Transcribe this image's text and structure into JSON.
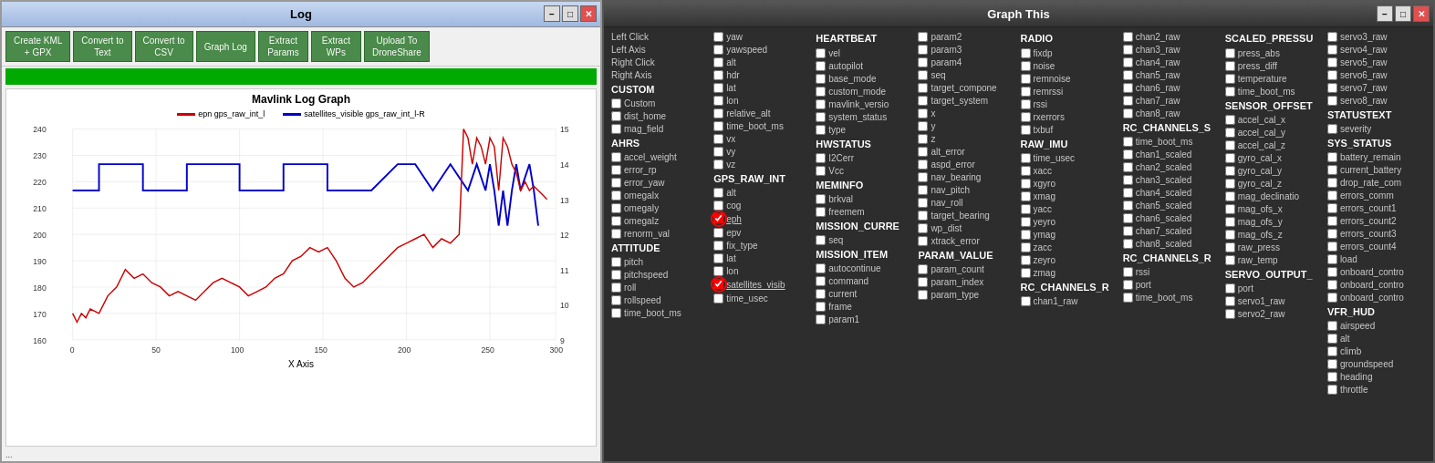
{
  "left_window": {
    "title": "Log",
    "controls": {
      "minimize": "−",
      "maximize": "□",
      "close": "✕"
    },
    "toolbar_buttons": [
      {
        "label": "Create KML\n+ GPX",
        "id": "create-kml"
      },
      {
        "label": "Convert to\nText",
        "id": "convert-text"
      },
      {
        "label": "Convert to\nCSV",
        "id": "convert-csv"
      },
      {
        "label": "Graph Log",
        "id": "graph-log"
      },
      {
        "label": "Extract\nParams",
        "id": "extract-params"
      },
      {
        "label": "Extract\nWPs",
        "id": "extract-wps"
      },
      {
        "label": "Upload To\nDroneShare",
        "id": "upload-droneshare"
      }
    ],
    "graph": {
      "title": "Mavlink Log Graph",
      "legend": [
        {
          "label": "epn gps_raw_int_l",
          "color": "#cc0000"
        },
        {
          "label": "satellites_visible gps_raw_int_l-R",
          "color": "#0000cc"
        }
      ],
      "y_axis_left_min": 150,
      "y_axis_left_max": 240,
      "y_axis_right_min": 7,
      "y_axis_right_max": 15,
      "x_axis_label": "X Axis",
      "x_axis_values": [
        "0",
        "50",
        "100",
        "150",
        "200",
        "250",
        "300"
      ],
      "footer": "..."
    }
  },
  "right_window": {
    "title": "Graph This",
    "controls": {
      "minimize": "−",
      "maximize": "□",
      "close": "✕"
    },
    "columns": [
      {
        "id": "col1",
        "header": "",
        "items": [
          {
            "type": "label",
            "text": "Left Click"
          },
          {
            "type": "label",
            "text": "Left Axis"
          },
          {
            "type": "label",
            "text": "Right Click"
          },
          {
            "type": "label",
            "text": "Right Axis"
          },
          {
            "type": "section",
            "text": "CUSTOM"
          },
          {
            "type": "checkbox",
            "text": "Custom"
          },
          {
            "type": "checkbox",
            "text": "dist_home"
          },
          {
            "type": "checkbox",
            "text": "mag_field"
          },
          {
            "type": "section",
            "text": "AHRS"
          },
          {
            "type": "checkbox",
            "text": "accel_weight"
          },
          {
            "type": "checkbox",
            "text": "error_rp"
          },
          {
            "type": "checkbox",
            "text": "error_yaw"
          },
          {
            "type": "checkbox",
            "text": "omegaIx"
          },
          {
            "type": "checkbox",
            "text": "omegaIy"
          },
          {
            "type": "checkbox",
            "text": "omegaIz"
          },
          {
            "type": "checkbox",
            "text": "renorm_val"
          },
          {
            "type": "section",
            "text": "ATTITUDE"
          },
          {
            "type": "checkbox",
            "text": "pitch"
          },
          {
            "type": "checkbox",
            "text": "pitchspeed"
          },
          {
            "type": "checkbox",
            "text": "roll"
          },
          {
            "type": "checkbox",
            "text": "rollspeed"
          },
          {
            "type": "checkbox",
            "text": "time_boot_ms"
          }
        ]
      },
      {
        "id": "col2",
        "header": "",
        "items": [
          {
            "type": "checkbox",
            "text": "yaw"
          },
          {
            "type": "checkbox",
            "text": "yawspeed"
          },
          {
            "type": "checkbox",
            "text": "alt"
          },
          {
            "type": "checkbox",
            "text": "hdr"
          },
          {
            "type": "checkbox",
            "text": "lat"
          },
          {
            "type": "checkbox",
            "text": "lon"
          },
          {
            "type": "checkbox",
            "text": "relative_alt"
          },
          {
            "type": "checkbox",
            "text": "time_boot_ms"
          },
          {
            "type": "checkbox",
            "text": "vx"
          },
          {
            "type": "checkbox",
            "text": "vy"
          },
          {
            "type": "checkbox",
            "text": "vz"
          },
          {
            "type": "section",
            "text": "GPS_RAW_INT"
          },
          {
            "type": "checkbox",
            "text": "alt"
          },
          {
            "type": "checkbox",
            "text": "cog"
          },
          {
            "type": "checkbox-circled",
            "text": "eph"
          },
          {
            "type": "checkbox",
            "text": "epv"
          },
          {
            "type": "checkbox",
            "text": "fix_type"
          },
          {
            "type": "checkbox",
            "text": "lat"
          },
          {
            "type": "checkbox",
            "text": "lon"
          },
          {
            "type": "checkbox-circled",
            "text": "satellites_visib"
          },
          {
            "type": "checkbox",
            "text": "time_usec"
          }
        ]
      },
      {
        "id": "col3",
        "header": "HEARTBEAT",
        "items": [
          {
            "type": "checkbox",
            "text": "vel"
          },
          {
            "type": "checkbox",
            "text": "autopilot"
          },
          {
            "type": "checkbox",
            "text": "base_mode"
          },
          {
            "type": "checkbox",
            "text": "custom_mode"
          },
          {
            "type": "checkbox",
            "text": "mavlink_versio"
          },
          {
            "type": "checkbox",
            "text": "system_status"
          },
          {
            "type": "checkbox",
            "text": "type"
          },
          {
            "type": "section",
            "text": "HWSTATUS"
          },
          {
            "type": "checkbox",
            "text": "I2Cerr"
          },
          {
            "type": "checkbox",
            "text": "Vcc"
          },
          {
            "type": "section",
            "text": "MEMINFO"
          },
          {
            "type": "checkbox",
            "text": "brkval"
          },
          {
            "type": "checkbox",
            "text": "freemem"
          },
          {
            "type": "section",
            "text": "MISSION_CURRE"
          },
          {
            "type": "checkbox",
            "text": "seq"
          },
          {
            "type": "section",
            "text": "MISSION_ITEM"
          },
          {
            "type": "checkbox",
            "text": "autocontinue"
          },
          {
            "type": "checkbox",
            "text": "command"
          },
          {
            "type": "checkbox",
            "text": "current"
          },
          {
            "type": "checkbox",
            "text": "frame"
          },
          {
            "type": "checkbox",
            "text": "param1"
          }
        ]
      },
      {
        "id": "col4",
        "header": "",
        "items": [
          {
            "type": "checkbox",
            "text": "param2"
          },
          {
            "type": "checkbox",
            "text": "param3"
          },
          {
            "type": "checkbox",
            "text": "param4"
          },
          {
            "type": "checkbox",
            "text": "seq"
          },
          {
            "type": "checkbox",
            "text": "target_compone"
          },
          {
            "type": "checkbox",
            "text": "target_system"
          },
          {
            "type": "checkbox",
            "text": "x"
          },
          {
            "type": "checkbox",
            "text": "y"
          },
          {
            "type": "checkbox",
            "text": "z"
          },
          {
            "type": "checkbox",
            "text": "alt_error"
          },
          {
            "type": "checkbox",
            "text": "aspd_error"
          },
          {
            "type": "checkbox",
            "text": "nav_bearing"
          },
          {
            "type": "checkbox",
            "text": "nav_pitch"
          },
          {
            "type": "checkbox",
            "text": "nav_roll"
          },
          {
            "type": "checkbox",
            "text": "target_bearing"
          },
          {
            "type": "checkbox",
            "text": "wp_dist"
          },
          {
            "type": "checkbox",
            "text": "xtrack_error"
          },
          {
            "type": "section",
            "text": "PARAM_VALUE"
          },
          {
            "type": "checkbox",
            "text": "param_count"
          },
          {
            "type": "checkbox",
            "text": "param_index"
          },
          {
            "type": "checkbox",
            "text": "param_type"
          }
        ]
      },
      {
        "id": "col5",
        "header": "RADIO",
        "items": [
          {
            "type": "checkbox",
            "text": "fixdp"
          },
          {
            "type": "checkbox",
            "text": "noise"
          },
          {
            "type": "checkbox",
            "text": "remnoise"
          },
          {
            "type": "checkbox",
            "text": "remrssi"
          },
          {
            "type": "checkbox",
            "text": "rssi"
          },
          {
            "type": "checkbox",
            "text": "rxerrors"
          },
          {
            "type": "checkbox",
            "text": "txbuf"
          },
          {
            "type": "section",
            "text": "RAW_IMU"
          },
          {
            "type": "checkbox",
            "text": "time_usec"
          },
          {
            "type": "checkbox",
            "text": "xacc"
          },
          {
            "type": "checkbox",
            "text": "xgyro"
          },
          {
            "type": "checkbox",
            "text": "xmag"
          },
          {
            "type": "checkbox",
            "text": "yacc"
          },
          {
            "type": "checkbox",
            "text": "yeyro"
          },
          {
            "type": "checkbox",
            "text": "ymag"
          },
          {
            "type": "checkbox",
            "text": "zacc"
          },
          {
            "type": "checkbox",
            "text": "zeyro"
          },
          {
            "type": "checkbox",
            "text": "zmag"
          },
          {
            "type": "section",
            "text": "RC_CHANNELS_R"
          },
          {
            "type": "checkbox",
            "text": "chan1_raw"
          }
        ]
      },
      {
        "id": "col6",
        "header": "",
        "items": [
          {
            "type": "checkbox",
            "text": "chan2_raw"
          },
          {
            "type": "checkbox",
            "text": "chan3_raw"
          },
          {
            "type": "checkbox",
            "text": "chan4_raw"
          },
          {
            "type": "checkbox",
            "text": "chan5_raw"
          },
          {
            "type": "checkbox",
            "text": "chan6_raw"
          },
          {
            "type": "checkbox",
            "text": "chan7_raw"
          },
          {
            "type": "checkbox",
            "text": "chan8_raw"
          },
          {
            "type": "section",
            "text": "RC_CHANNELS_S"
          },
          {
            "type": "checkbox",
            "text": "time_boot_ms"
          },
          {
            "type": "checkbox",
            "text": "chan1_scaled"
          },
          {
            "type": "checkbox",
            "text": "chan2_scaled"
          },
          {
            "type": "checkbox",
            "text": "chan3_scaled"
          },
          {
            "type": "checkbox",
            "text": "chan4_scaled"
          },
          {
            "type": "checkbox",
            "text": "chan5_scaled"
          },
          {
            "type": "checkbox",
            "text": "chan6_scaled"
          },
          {
            "type": "checkbox",
            "text": "chan7_scaled"
          },
          {
            "type": "checkbox",
            "text": "chan8_scaled"
          },
          {
            "type": "section",
            "text": "RC_CHANNELS_R"
          },
          {
            "type": "checkbox",
            "text": "rssi"
          },
          {
            "type": "checkbox",
            "text": "port"
          },
          {
            "type": "checkbox",
            "text": "time_boot_ms"
          }
        ]
      },
      {
        "id": "col7",
        "header": "SCALED_PRESSU",
        "items": [
          {
            "type": "checkbox",
            "text": "press_abs"
          },
          {
            "type": "checkbox",
            "text": "press_diff"
          },
          {
            "type": "checkbox",
            "text": "temperature"
          },
          {
            "type": "checkbox",
            "text": "time_boot_ms"
          },
          {
            "type": "section",
            "text": "SENSOR_OFFSET"
          },
          {
            "type": "checkbox",
            "text": "accel_cal_x"
          },
          {
            "type": "checkbox",
            "text": "accel_cal_y"
          },
          {
            "type": "checkbox",
            "text": "accel_cal_z"
          },
          {
            "type": "checkbox",
            "text": "gyro_cal_x"
          },
          {
            "type": "checkbox",
            "text": "gyro_cal_y"
          },
          {
            "type": "checkbox",
            "text": "gyro_cal_z"
          },
          {
            "type": "checkbox",
            "text": "mag_declinatio"
          },
          {
            "type": "checkbox",
            "text": "mag_ofs_x"
          },
          {
            "type": "checkbox",
            "text": "mag_ofs_y"
          },
          {
            "type": "checkbox",
            "text": "mag_ofs_z"
          },
          {
            "type": "checkbox",
            "text": "raw_press"
          },
          {
            "type": "checkbox",
            "text": "raw_temp"
          },
          {
            "type": "section",
            "text": "SERVO_OUTPUT_"
          },
          {
            "type": "checkbox",
            "text": "port"
          },
          {
            "type": "checkbox",
            "text": "servo1_raw"
          },
          {
            "type": "checkbox",
            "text": "servo2_raw"
          }
        ]
      },
      {
        "id": "col8",
        "header": "",
        "items": [
          {
            "type": "checkbox",
            "text": "servo3_raw"
          },
          {
            "type": "checkbox",
            "text": "servo4_raw"
          },
          {
            "type": "checkbox",
            "text": "servo5_raw"
          },
          {
            "type": "checkbox",
            "text": "servo6_raw"
          },
          {
            "type": "checkbox",
            "text": "servo7_raw"
          },
          {
            "type": "checkbox",
            "text": "servo8_raw"
          },
          {
            "type": "section",
            "text": "STATUSTEXT"
          },
          {
            "type": "checkbox",
            "text": "severity"
          },
          {
            "type": "section",
            "text": "SYS_STATUS"
          },
          {
            "type": "checkbox",
            "text": "battery_remain"
          },
          {
            "type": "checkbox",
            "text": "current_battery"
          },
          {
            "type": "checkbox",
            "text": "drop_rate_com"
          },
          {
            "type": "checkbox",
            "text": "errors_comm"
          },
          {
            "type": "checkbox",
            "text": "errors_count1"
          },
          {
            "type": "checkbox",
            "text": "errors_count2"
          },
          {
            "type": "checkbox",
            "text": "errors_count3"
          },
          {
            "type": "checkbox",
            "text": "errors_count4"
          },
          {
            "type": "checkbox",
            "text": "load"
          },
          {
            "type": "checkbox",
            "text": "onboard_contro"
          },
          {
            "type": "checkbox",
            "text": "onboard_contro"
          },
          {
            "type": "checkbox",
            "text": "onboard_contro"
          },
          {
            "type": "section",
            "text": "VFR_HUD"
          },
          {
            "type": "checkbox",
            "text": "airspeed"
          },
          {
            "type": "checkbox",
            "text": "alt"
          },
          {
            "type": "checkbox",
            "text": "climb"
          },
          {
            "type": "checkbox",
            "text": "groundspeed"
          },
          {
            "type": "checkbox",
            "text": "heading"
          },
          {
            "type": "checkbox",
            "text": "throttle"
          }
        ]
      }
    ]
  }
}
